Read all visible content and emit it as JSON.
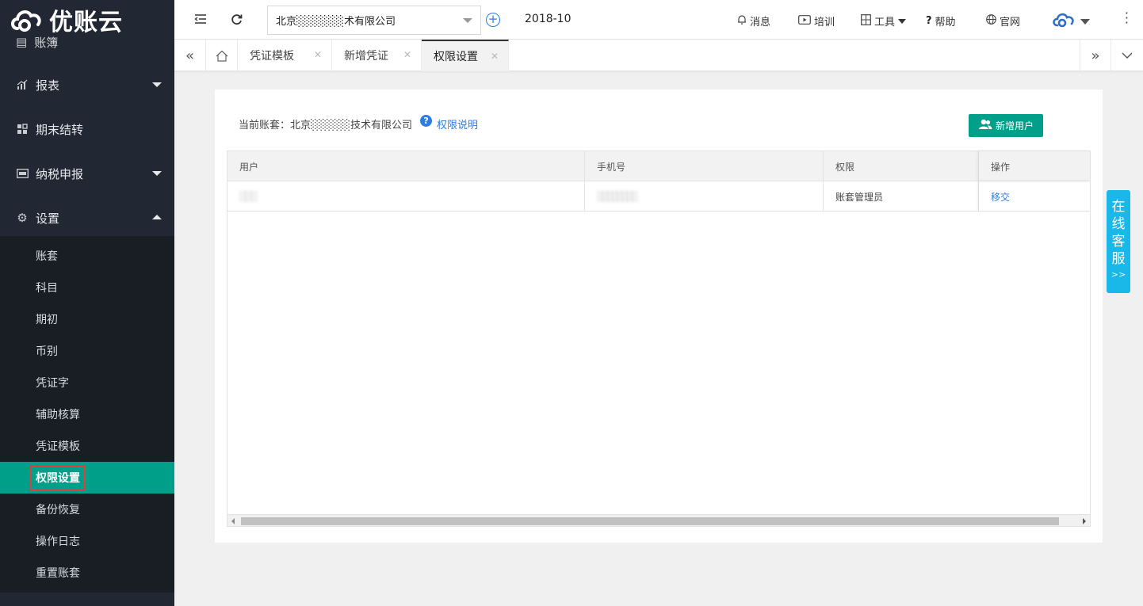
{
  "app": {
    "logo_text": "优账云"
  },
  "sidebar": {
    "top_partial": "账簿",
    "menus": [
      {
        "label": "报表",
        "icon": "bar-chart-icon",
        "expanded": false
      },
      {
        "label": "期末结转",
        "icon": "grid-icon",
        "expanded": false
      },
      {
        "label": "纳税申报",
        "icon": "tax-icon",
        "expanded": false
      },
      {
        "label": "设置",
        "icon": "gear-icon",
        "expanded": true
      }
    ],
    "settings_items": [
      "账套",
      "科目",
      "期初",
      "币别",
      "凭证字",
      "辅助核算",
      "凭证模板",
      "权限设置",
      "备份恢复",
      "操作日志",
      "重置账套"
    ],
    "active_item": "权限设置"
  },
  "topbar": {
    "company": "北京░░░░░░术有限公司",
    "period": "2018-10",
    "links": [
      "消息",
      "培训",
      "工具",
      "帮助",
      "官网"
    ]
  },
  "tabs": [
    "凭证模板",
    "新增凭证",
    "权限设置"
  ],
  "content": {
    "account_label": "当前账套：",
    "account_name": "北京░░░░░技术有限公司",
    "help_link": "权限说明",
    "add_user_button": "新增用户",
    "table": {
      "headers": [
        "用户",
        "手机号",
        "权限",
        "操作"
      ],
      "rows": [
        {
          "user": "░░░",
          "phone": "░░░░░░░░",
          "permission": "账套管理员",
          "action": "移交"
        }
      ]
    }
  },
  "service": {
    "chars": [
      "在",
      "线",
      "客",
      "服"
    ],
    "arrow": ">>"
  },
  "colors": {
    "accent": "#009f8a",
    "link": "#2f7ddf",
    "sidebar": "#222833",
    "service": "#1ab8e8"
  }
}
